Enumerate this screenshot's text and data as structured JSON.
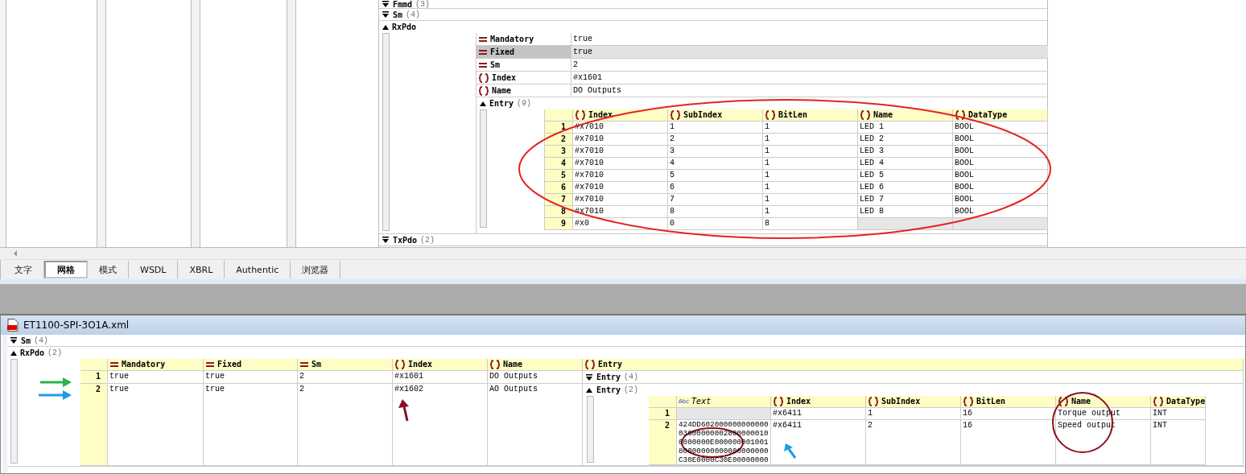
{
  "top_grid": {
    "rows": [
      {
        "label": "Fmmd",
        "count": "(3)",
        "expanded": false
      },
      {
        "label": "Sm",
        "count": "(4)",
        "expanded": false
      }
    ],
    "rxpdo": {
      "label": "RxPdo",
      "expanded": true,
      "attributes": [
        {
          "kind": "attribute",
          "name": "Mandatory",
          "value": "true",
          "selected": false
        },
        {
          "kind": "attribute",
          "name": "Fixed",
          "value": "true",
          "selected": true
        },
        {
          "kind": "attribute",
          "name": "Sm",
          "value": "2",
          "selected": false
        },
        {
          "kind": "element",
          "name": "Index",
          "value": "#x1601",
          "selected": false
        },
        {
          "kind": "element",
          "name": "Name",
          "value": "DO Outputs",
          "selected": false
        }
      ],
      "entry": {
        "label": "Entry",
        "count": "(9)",
        "expanded": true,
        "columns": [
          {
            "kind": "element",
            "label": "Index"
          },
          {
            "kind": "element",
            "label": "SubIndex"
          },
          {
            "kind": "element",
            "label": "BitLen"
          },
          {
            "kind": "element",
            "label": "Name"
          },
          {
            "kind": "element",
            "label": "DataType"
          }
        ],
        "rows": [
          {
            "num": "1",
            "cells": [
              "#x7010",
              "1",
              "1",
              "LED 1",
              "BOOL"
            ]
          },
          {
            "num": "2",
            "cells": [
              "#x7010",
              "2",
              "1",
              "LED 2",
              "BOOL"
            ]
          },
          {
            "num": "3",
            "cells": [
              "#x7010",
              "3",
              "1",
              "LED 3",
              "BOOL"
            ]
          },
          {
            "num": "4",
            "cells": [
              "#x7010",
              "4",
              "1",
              "LED 4",
              "BOOL"
            ]
          },
          {
            "num": "5",
            "cells": [
              "#x7010",
              "5",
              "1",
              "LED 5",
              "BOOL"
            ]
          },
          {
            "num": "6",
            "cells": [
              "#x7010",
              "6",
              "1",
              "LED 6",
              "BOOL"
            ]
          },
          {
            "num": "7",
            "cells": [
              "#x7010",
              "7",
              "1",
              "LED 7",
              "BOOL"
            ]
          },
          {
            "num": "8",
            "cells": [
              "#x7010",
              "8",
              "1",
              "LED 8",
              "BOOL"
            ]
          },
          {
            "num": "9",
            "cells": [
              "#x0",
              "0",
              "8",
              null,
              null
            ]
          }
        ]
      }
    },
    "txpdo": {
      "label": "TxPdo",
      "count": "(2)",
      "expanded": false
    }
  },
  "tabs": [
    {
      "label": "文字",
      "selected": false
    },
    {
      "label": "网格",
      "selected": true
    },
    {
      "label": "模式",
      "selected": false
    },
    {
      "label": "WSDL",
      "selected": false
    },
    {
      "label": "XBRL",
      "selected": false
    },
    {
      "label": "Authentic",
      "selected": false
    },
    {
      "label": "浏览器",
      "selected": false
    }
  ],
  "document": {
    "title": "ET1100-SPI-3O1A.xml",
    "rows": [
      {
        "label": "Sm",
        "count": "(4)",
        "expanded": false
      }
    ],
    "rxpdo": {
      "label": "RxPdo",
      "count": "(2)",
      "expanded": true,
      "columns": [
        {
          "kind": "attribute",
          "label": "Mandatory"
        },
        {
          "kind": "attribute",
          "label": "Fixed"
        },
        {
          "kind": "attribute",
          "label": "Sm"
        },
        {
          "kind": "element",
          "label": "Index"
        },
        {
          "kind": "element",
          "label": "Name"
        },
        {
          "kind": "element",
          "label": "Entry"
        }
      ],
      "rows": [
        {
          "num": "1",
          "cells": [
            "true",
            "true",
            "2",
            "#x1601",
            "DO Outputs"
          ],
          "entry": {
            "label": "Entry",
            "count": "(4)",
            "expanded": false
          }
        },
        {
          "num": "2",
          "cells": [
            "true",
            "true",
            "2",
            "#x1602",
            "AO Outputs"
          ],
          "entry": {
            "label": "Entry",
            "count": "(2)",
            "expanded": true,
            "columns": [
              {
                "kind": "text",
                "icon_text": "Abc",
                "label": "Text"
              },
              {
                "kind": "element",
                "label": "Index"
              },
              {
                "kind": "element",
                "label": "SubIndex"
              },
              {
                "kind": "element",
                "label": "BitLen"
              },
              {
                "kind": "element",
                "label": "Name"
              },
              {
                "kind": "element",
                "label": "DataType"
              }
            ],
            "rows": [
              {
                "num": "1",
                "cells": [
                  null,
                  "#x6411",
                  "1",
                  "16",
                  "Torque output",
                  "INT"
                ]
              },
              {
                "num": "2",
                "cells": [
                  "424DD602000000000000036000000028000000100000000E00000000100180000000000000000000C30E0000C30E00000000",
                  "#x6411",
                  "2",
                  "16",
                  "Speed output",
                  "INT"
                ]
              }
            ]
          }
        }
      ]
    }
  }
}
